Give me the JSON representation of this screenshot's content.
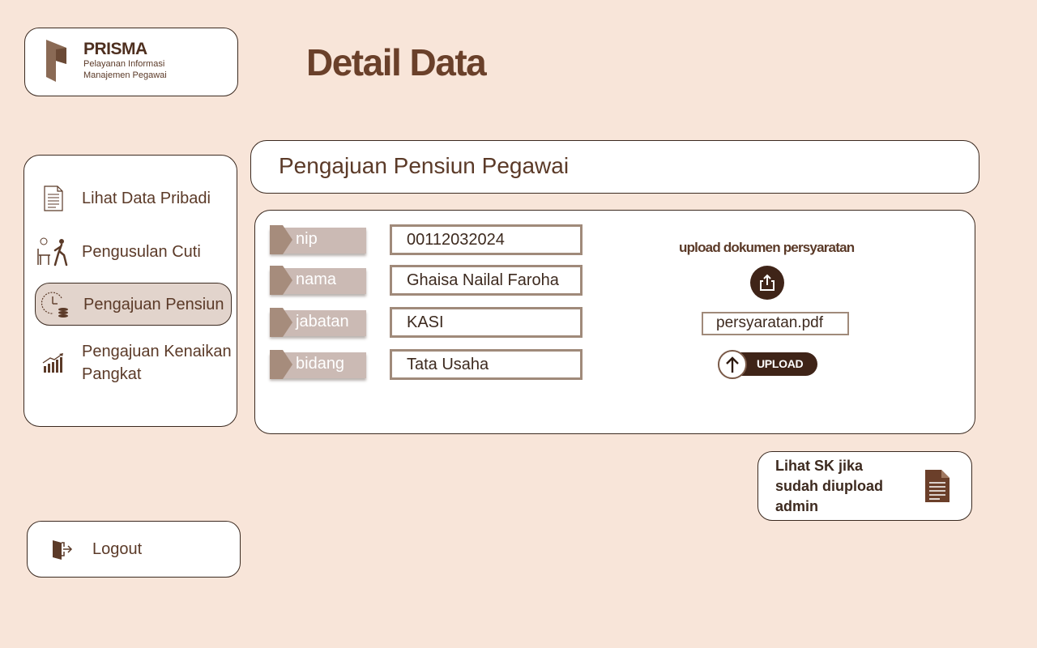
{
  "brand": {
    "name": "PRISMA",
    "tagline_line1": "Pelayanan Informasi",
    "tagline_line2": "Manajemen Pegawai"
  },
  "page_title": "Detail Data",
  "sidebar": {
    "items": [
      {
        "label": "Lihat Data Pribadi",
        "icon": "document-icon",
        "active": false
      },
      {
        "label": "Pengusulan Cuti",
        "icon": "leave-walk-icon",
        "active": false
      },
      {
        "label": "Pengajuan Pensiun",
        "icon": "clock-coins-icon",
        "active": true
      },
      {
        "label": "Pengajuan Kenaikan Pangkat",
        "icon": "growth-chart-icon",
        "active": false
      }
    ],
    "logout_label": "Logout"
  },
  "section_title": "Pengajuan Pensiun Pegawai",
  "form": {
    "fields": [
      {
        "label": "nip",
        "value": "00112032024"
      },
      {
        "label": "nama",
        "value": "Ghaisa Nailal Faroha"
      },
      {
        "label": "jabatan",
        "value": "KASI"
      },
      {
        "label": "bidang",
        "value": "Tata Usaha"
      }
    ]
  },
  "upload": {
    "title": "upload dokumen persyaratan",
    "file_name": "persyaratan.pdf",
    "button_label": "UPLOAD"
  },
  "sk_link": {
    "label": "Lihat SK jika sudah diupload admin"
  },
  "colors": {
    "background": "#f8e5d9",
    "primary_dark": "#3f2418",
    "text": "#5b3a28",
    "tag_fill": "#cbbab4",
    "active_nav": "#e2d4cc"
  }
}
